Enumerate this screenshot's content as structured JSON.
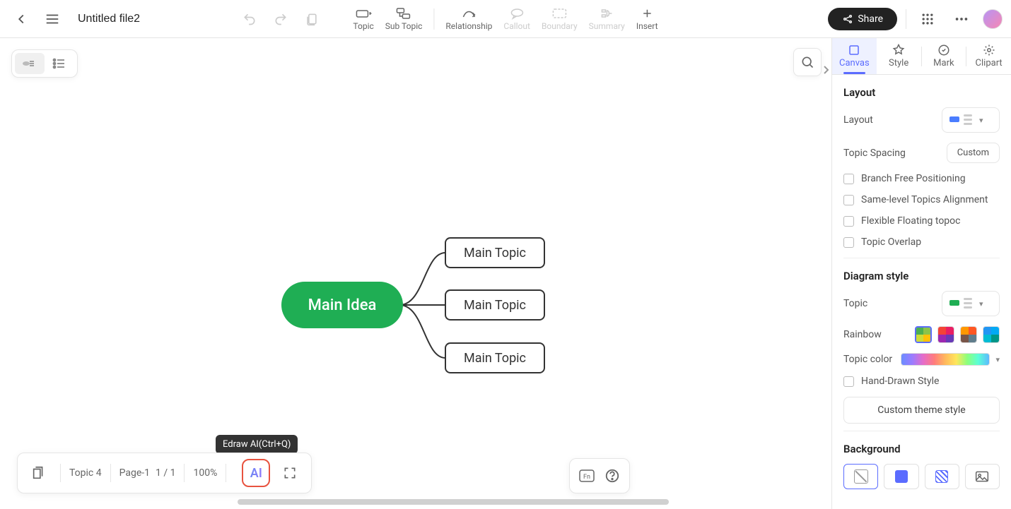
{
  "header": {
    "filename": "Untitled file2",
    "tools": {
      "topic": "Topic",
      "sub_topic": "Sub Topic",
      "relationship": "Relationship",
      "callout": "Callout",
      "boundary": "Boundary",
      "summary": "Summary",
      "insert": "Insert"
    },
    "share_label": "Share"
  },
  "mindmap": {
    "main_idea": "Main Idea",
    "topics": [
      "Main Topic",
      "Main Topic",
      "Main Topic"
    ]
  },
  "tooltip_ai": "Edraw AI(Ctrl+Q)",
  "bottom": {
    "topic_count_label": "Topic 4",
    "page_label": "Page-1",
    "page_count": "1 / 1",
    "zoom": "100%",
    "ai_label": "AI"
  },
  "sidebar": {
    "tabs": {
      "canvas": "Canvas",
      "style": "Style",
      "mark": "Mark",
      "clipart": "Clipart"
    },
    "layout": {
      "section": "Layout",
      "layout_label": "Layout",
      "topic_spacing_label": "Topic Spacing",
      "custom_label": "Custom",
      "branch_free": "Branch Free Positioning",
      "same_level": "Same-level Topics Alignment",
      "flexible": "Flexible Floating topoc",
      "overlap": "Topic Overlap"
    },
    "diagram": {
      "section": "Diagram style",
      "topic_label": "Topic",
      "rainbow_label": "Rainbow",
      "topic_color_label": "Topic color",
      "hand_drawn": "Hand-Drawn Style",
      "custom_theme": "Custom theme style"
    },
    "background": {
      "section": "Background"
    }
  }
}
